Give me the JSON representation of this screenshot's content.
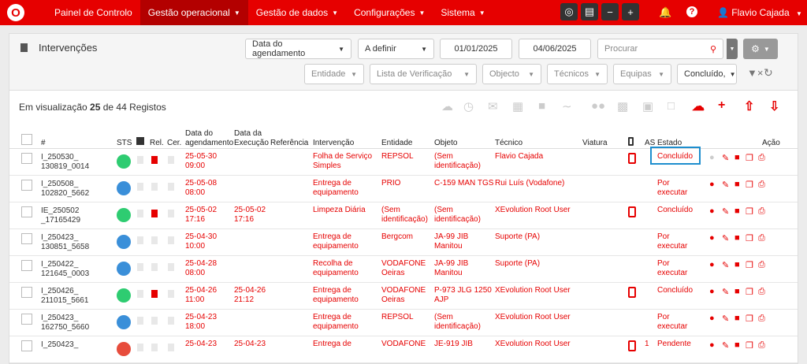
{
  "nav": {
    "items": [
      {
        "label": "Painel de Controlo",
        "has_caret": false,
        "active": false
      },
      {
        "label": "Gestão operacional",
        "has_caret": true,
        "active": true
      },
      {
        "label": "Gestão de dados",
        "has_caret": true,
        "active": false
      },
      {
        "label": "Configurações",
        "has_caret": true,
        "active": false
      },
      {
        "label": "Sistema",
        "has_caret": true,
        "active": false
      }
    ],
    "user": "Flavio Cajada"
  },
  "panel": {
    "title": "Intervenções",
    "filters": {
      "date_type": "Data do agendamento",
      "period": "A definir",
      "date_from": "01/01/2025",
      "date_to": "04/06/2025",
      "search_placeholder": "Procurar",
      "entidade": "Entidade",
      "lista": "Lista de Verificação",
      "objecto": "Objecto",
      "tecnicos": "Técnicos",
      "equipas": "Equipas",
      "estado": "Concluído,"
    },
    "count": {
      "prefix": "Em visualização ",
      "shown": "25",
      "middle": " de ",
      "total": "44",
      "suffix": " Registos"
    }
  },
  "table": {
    "headers": {
      "num": "#",
      "sts": "STS",
      "rel": "Rel.",
      "cer": "Cer.",
      "data_ag_1": "Data do",
      "data_ag_2": "agendamento",
      "data_ex_1": "Data da",
      "data_ex_2": "Execução",
      "ref": "Referência",
      "interv": "Intervenção",
      "entidade": "Entidade",
      "objeto": "Objeto",
      "tecnico": "Técnico",
      "viatura": "Viatura",
      "as": "AS",
      "estado": "Estado",
      "acao": "Ação"
    },
    "rows": [
      {
        "id1": "I_250530_",
        "id2": "130819_0014",
        "sts": "#2ecc71",
        "rel": true,
        "ag1": "25-05-30",
        "ag2": "09:00",
        "ex1": "",
        "ex2": "",
        "int1": "Folha de Serviço",
        "int2": "Simples",
        "ent1": "REPSOL",
        "ent2": "",
        "obj1": "(Sem",
        "obj2": "identificação)",
        "tec": "Flavio Cajada",
        "phone": true,
        "as": "",
        "est1": "Concluído",
        "est2": ""
      },
      {
        "id1": "I_250508_",
        "id2": "102820_5662",
        "sts": "#3a8fd9",
        "rel": false,
        "ag1": "25-05-08",
        "ag2": "08:00",
        "ex1": "",
        "ex2": "",
        "int1": "Entrega de",
        "int2": "equipamento",
        "ent1": "PRIO",
        "ent2": "",
        "obj1": "C-159 MAN TGS",
        "obj2": "",
        "tec": "Rui Luís (Vodafone)",
        "phone": false,
        "as": "",
        "est1": "Por",
        "est2": "executar"
      },
      {
        "id1": "IE_250502",
        "id2": "_17165429",
        "sts": "#2ecc71",
        "rel": true,
        "ag1": "25-05-02",
        "ag2": "17:16",
        "ex1": "25-05-02",
        "ex2": "17:16",
        "int1": "Limpeza Diária",
        "int2": "",
        "ent1": "(Sem",
        "ent2": "identificação)",
        "obj1": "(Sem",
        "obj2": "identificação)",
        "tec": "XEvolution Root User",
        "phone": true,
        "as": "",
        "est1": "Concluído",
        "est2": ""
      },
      {
        "id1": "I_250423_",
        "id2": "130851_5658",
        "sts": "#3a8fd9",
        "rel": false,
        "ag1": "25-04-30",
        "ag2": "10:00",
        "ex1": "",
        "ex2": "",
        "int1": "Entrega de",
        "int2": "equipamento",
        "ent1": "Bergcom",
        "ent2": "",
        "obj1": "JA-99 JIB",
        "obj2": "Manitou",
        "tec": "Suporte (PA)",
        "phone": false,
        "as": "",
        "est1": "Por",
        "est2": "executar"
      },
      {
        "id1": "I_250422_",
        "id2": "121645_0003",
        "sts": "#3a8fd9",
        "rel": false,
        "ag1": "25-04-28",
        "ag2": "08:00",
        "ex1": "",
        "ex2": "",
        "int1": "Recolha de",
        "int2": "equipamento",
        "ent1": "VODAFONE",
        "ent2": "Oeiras",
        "obj1": "JA-99 JIB",
        "obj2": "Manitou",
        "tec": "Suporte (PA)",
        "phone": false,
        "as": "",
        "est1": "Por",
        "est2": "executar"
      },
      {
        "id1": "I_250426_",
        "id2": "211015_5661",
        "sts": "#2ecc71",
        "rel": true,
        "ag1": "25-04-26",
        "ag2": "11:00",
        "ex1": "25-04-26",
        "ex2": "21:12",
        "int1": "Entrega de",
        "int2": "equipamento",
        "ent1": "VODAFONE",
        "ent2": "Oeiras",
        "obj1": "P-973 JLG 1250",
        "obj2": "AJP",
        "tec": "XEvolution Root User",
        "phone": true,
        "as": "",
        "est1": "Concluído",
        "est2": ""
      },
      {
        "id1": "I_250423_",
        "id2": "162750_5660",
        "sts": "#3a8fd9",
        "rel": false,
        "ag1": "25-04-23",
        "ag2": "18:00",
        "ex1": "",
        "ex2": "",
        "int1": "Entrega de",
        "int2": "equipamento",
        "ent1": "REPSOL",
        "ent2": "",
        "obj1": "(Sem",
        "obj2": "identificação)",
        "tec": "XEvolution Root User",
        "phone": false,
        "as": "",
        "est1": "Por",
        "est2": "executar"
      },
      {
        "id1": "I_250423_",
        "id2": "",
        "sts": "#e74c3c",
        "rel": false,
        "ag1": "25-04-23",
        "ag2": "",
        "ex1": "25-04-23",
        "ex2": "",
        "int1": "Entrega de",
        "int2": "",
        "ent1": "VODAFONE",
        "ent2": "",
        "obj1": "JE-919 JIB",
        "obj2": "",
        "tec": "XEvolution Root User",
        "phone": true,
        "as": "1",
        "est1": "Pendente",
        "est2": ""
      }
    ]
  },
  "colors": {
    "brand": "#e60000",
    "highlight": "#1e8ece"
  }
}
